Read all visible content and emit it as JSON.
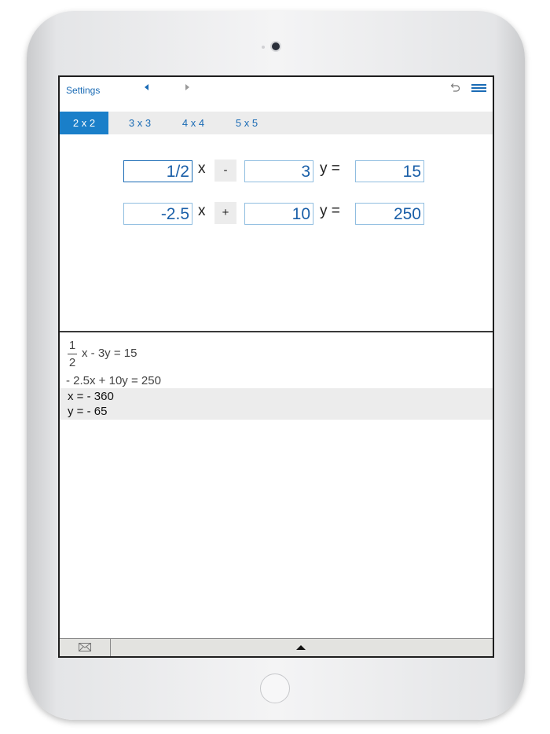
{
  "navbar": {
    "settings_label": "Settings",
    "prev_icon": "chevron-left-icon",
    "next_icon": "chevron-right-icon",
    "undo_icon": "undo-icon",
    "menu_icon": "menu-icon"
  },
  "tabs": [
    {
      "label": "2 x 2",
      "active": true
    },
    {
      "label": "3 x 3",
      "active": false
    },
    {
      "label": "4 x 4",
      "active": false
    },
    {
      "label": "5 x 5",
      "active": false
    }
  ],
  "equations": [
    {
      "a": "1/2",
      "x_label": "x",
      "op": "-",
      "b": "3",
      "y_label": "y =",
      "c": "15"
    },
    {
      "a": "-2.5",
      "x_label": "x",
      "op": "+",
      "b": "10",
      "y_label": "y =",
      "c": "250"
    }
  ],
  "results": {
    "eq1_frac_num": "1",
    "eq1_frac_den": "2",
    "eq1_rest": "x - 3y = 15",
    "eq2": "- 2.5x + 10y = 250",
    "solution_x": "x = - 360",
    "solution_y": "y = - 65"
  },
  "footer": {
    "mail_icon": "mail-icon",
    "expand_icon": "triangle-up-icon"
  },
  "colors": {
    "accent": "#1a6bb5",
    "active_tab": "#1a7fc9",
    "input_border": "#8fbde0"
  }
}
